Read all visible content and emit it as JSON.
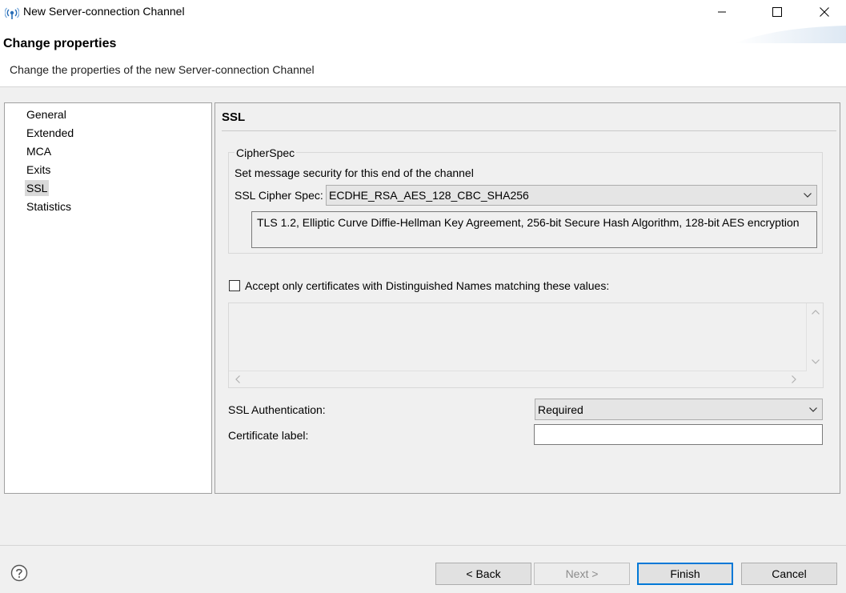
{
  "window": {
    "title": "New Server-connection Channel",
    "app_icon": "server-connection-icon"
  },
  "header": {
    "title": "Change properties",
    "description": "Change the properties of the new Server-connection Channel"
  },
  "tree": {
    "items": [
      {
        "label": "General"
      },
      {
        "label": "Extended"
      },
      {
        "label": "MCA"
      },
      {
        "label": "Exits"
      },
      {
        "label": "SSL",
        "selected": true
      },
      {
        "label": "Statistics"
      }
    ]
  },
  "panel": {
    "title": "SSL",
    "cipherspec": {
      "legend": "CipherSpec",
      "instruction": "Set message security for this end of the channel",
      "cipher_label": "SSL Cipher Spec:",
      "cipher_value": "ECDHE_RSA_AES_128_CBC_SHA256",
      "cipher_description": "TLS 1.2, Elliptic Curve Diffie-Hellman Key Agreement, 256-bit Secure Hash Algorithm, 128-bit AES encryption"
    },
    "dn_filter": {
      "checkbox_label": "Accept only certificates with Distinguished Names matching these values:",
      "checked": false
    },
    "ssl_auth": {
      "label": "SSL Authentication:",
      "value": "Required"
    },
    "cert_label": {
      "label": "Certificate label:",
      "value": ""
    }
  },
  "footer": {
    "help_icon": "help-icon",
    "back_label": "< Back",
    "next_label": "Next >",
    "finish_label": "Finish",
    "cancel_label": "Cancel"
  },
  "colors": {
    "accent": "#0078d7",
    "selection": "#d9d9d9"
  }
}
